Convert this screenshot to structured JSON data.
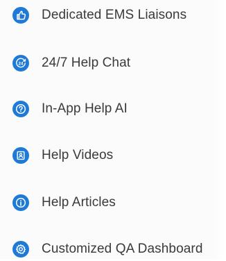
{
  "features": {
    "items": [
      {
        "label": "Dedicated EMS Liaisons",
        "icon": "thumbs-up-icon"
      },
      {
        "label": "24/7 Help Chat",
        "icon": "24-hour-icon"
      },
      {
        "label": "In-App Help AI",
        "icon": "question-mark-icon"
      },
      {
        "label": "Help Videos",
        "icon": "video-tutorial-icon"
      },
      {
        "label": "Help Articles",
        "icon": "info-icon"
      },
      {
        "label": "Customized QA Dashboard",
        "icon": "gear-icon"
      }
    ]
  },
  "colors": {
    "icon_background": "#1f7ad6",
    "icon_foreground": "#ffffff",
    "text": "#3a3a3a",
    "panel_background": "#fbfbfb"
  }
}
